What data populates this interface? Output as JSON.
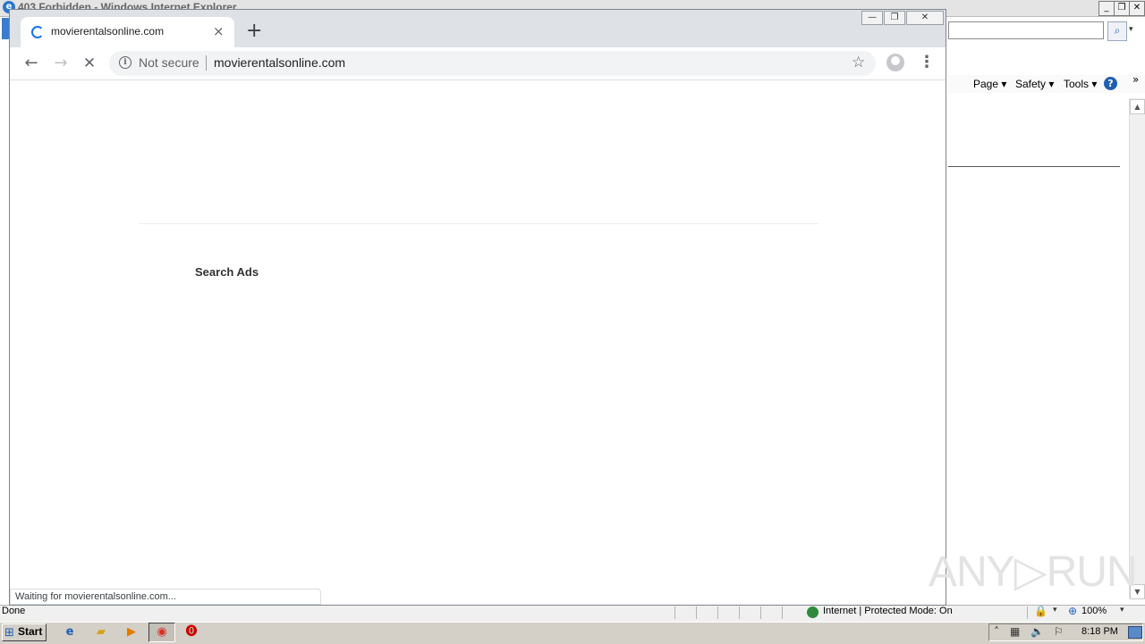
{
  "ie": {
    "title": "403 Forbidden - Windows Internet Explorer",
    "cmdbar": {
      "page_label": "Page ▾",
      "safety_label": "Safety ▾",
      "tools_label": "Tools ▾",
      "help_label": "?"
    },
    "status": {
      "left": "Done",
      "zone": "Internet | Protected Mode: On",
      "zoom": "100%"
    }
  },
  "chrome": {
    "tab": {
      "title": "movierentalsonline.com",
      "close": "×"
    },
    "new_tab": "+",
    "toolbar": {
      "back": "←",
      "forward": "→",
      "stop": "✕",
      "star": "☆",
      "menu": "⋮"
    },
    "omnibox": {
      "security": "Not secure",
      "url": "movierentalsonline.com"
    },
    "window_buttons": {
      "minimize": "—",
      "restore": "❐",
      "close": "✕"
    },
    "page": {
      "search_ads": "Search Ads"
    },
    "status": "Waiting for movierentalsonline.com..."
  },
  "watermark": "ANY▷RUN",
  "taskbar": {
    "start_label": "Start",
    "clock": "8:18 PM"
  },
  "colors": {
    "accent": "#1a73e8",
    "tabstrip": "#dee1e6",
    "omnibox": "#f1f3f4",
    "taskbar": "#d4d0c8"
  }
}
